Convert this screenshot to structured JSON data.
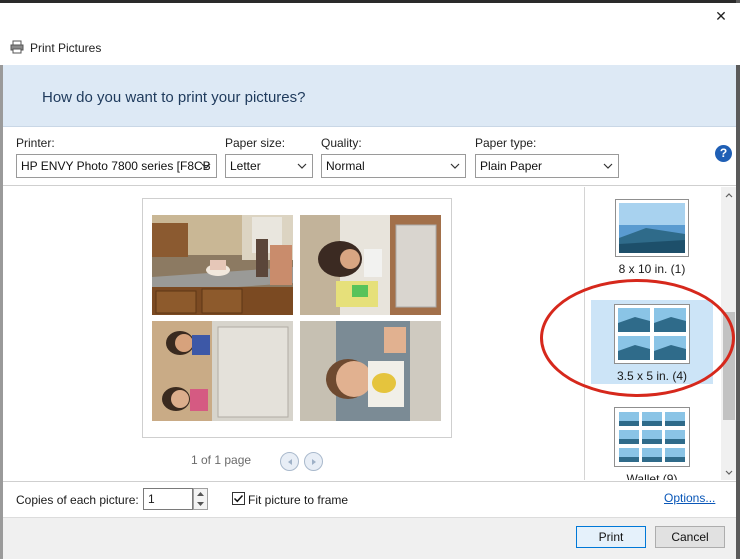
{
  "window": {
    "title": "Print Pictures",
    "close_glyph": "✕"
  },
  "header": {
    "question": "How do you want to print your pictures?"
  },
  "options": {
    "printer": {
      "label": "Printer:",
      "value": "HP ENVY Photo 7800 series [F8CB"
    },
    "paper_size": {
      "label": "Paper size:",
      "value": "Letter"
    },
    "quality": {
      "label": "Quality:",
      "value": "Normal"
    },
    "paper_type": {
      "label": "Paper type:",
      "value": "Plain Paper"
    },
    "help_glyph": "?"
  },
  "preview": {
    "page_indicator": "1 of 1 page",
    "photos": [
      {
        "description": "kitchen-birthday-cake-photo"
      },
      {
        "description": "girl-at-table-rotated-photo"
      },
      {
        "description": "women-at-table-rotated-photo"
      },
      {
        "description": "boy-at-table-rotated-photo"
      }
    ]
  },
  "layouts": {
    "items": [
      {
        "label": "8 x 10 in. (1)",
        "selected": false
      },
      {
        "label": "3.5 x 5 in. (4)",
        "selected": true
      },
      {
        "label": "Wallet (9)",
        "selected": false
      }
    ]
  },
  "bottom": {
    "copies_label": "Copies of each picture:",
    "copies_value": "1",
    "fit_label": "Fit picture to frame",
    "fit_checked": true,
    "options_link": "Options..."
  },
  "footer": {
    "print_label": "Print",
    "cancel_label": "Cancel"
  },
  "colors": {
    "accent": "#0078d7",
    "header_band": "#dde9f5",
    "annotation_ring": "#d6281c"
  }
}
